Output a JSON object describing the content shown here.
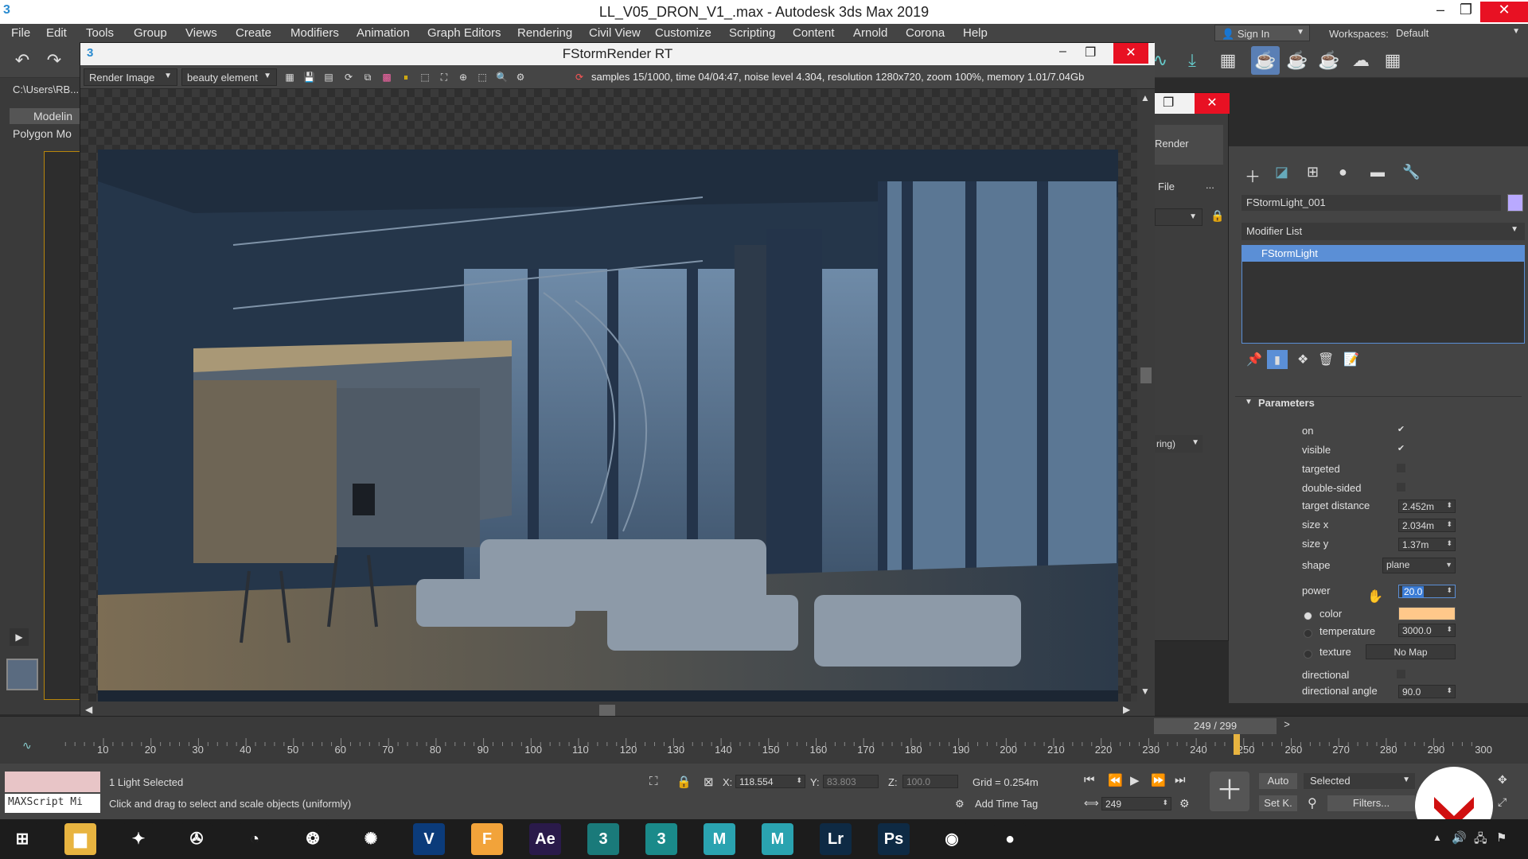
{
  "window": {
    "title": "LL_V05_DRON_V1_.max - Autodesk 3ds Max 2019"
  },
  "menu": [
    "File",
    "Edit",
    "Tools",
    "Group",
    "Views",
    "Create",
    "Modifiers",
    "Animation",
    "Graph Editors",
    "Rendering",
    "Civil View",
    "Customize",
    "Scripting",
    "Content",
    "Arnold",
    "Corona",
    "Help"
  ],
  "account": {
    "sign_in": "Sign In",
    "workspaces_label": "Workspaces:",
    "workspace": "Default"
  },
  "left": {
    "path": "C:\\Users\\RB...",
    "ribbon_tab": "Modelin",
    "ribbon_sub": "Polygon Mo",
    "viewport_label": "[+]["
  },
  "render_window": {
    "title": "FStormRender RT",
    "render_dropdown": "Render Image",
    "element_dropdown": "beauty element",
    "status": "samples 15/1000,  time 04/04:47,  noise level 4.304,  resolution 1280x720,  zoom 100%,  memory 1.01/7.04Gb"
  },
  "bg_dialog": {
    "render_label": "Render",
    "file_label": "File",
    "more": "...",
    "dropdown_tail": "ring)"
  },
  "command_panel": {
    "object_name": "FStormLight_001",
    "modifier_list": "Modifier List",
    "stack_item": "FStormLight",
    "rollout_title": "Parameters",
    "params": {
      "on": {
        "label": "on",
        "checked": true
      },
      "visible": {
        "label": "visible",
        "checked": true
      },
      "targeted": {
        "label": "targeted",
        "checked": false
      },
      "double_sided": {
        "label": "double-sided",
        "checked": false
      },
      "target_distance": {
        "label": "target distance",
        "value": "2.452m"
      },
      "size_x": {
        "label": "size x",
        "value": "2.034m"
      },
      "size_y": {
        "label": "size y",
        "value": "1.37m"
      },
      "shape": {
        "label": "shape",
        "value": "plane"
      },
      "power": {
        "label": "power",
        "value": "20.0"
      },
      "color": {
        "label": "color",
        "swatch": "#ffc88a"
      },
      "temperature": {
        "label": "temperature",
        "value": "3000.0"
      },
      "texture": {
        "label": "texture",
        "value": "No Map"
      },
      "directional": {
        "label": "directional",
        "checked": false
      },
      "directional_angle": {
        "label": "directional angle",
        "value": "90.0"
      }
    }
  },
  "timeline": {
    "frame_counter": "249 / 299",
    "next": ">",
    "ticks": [
      "10",
      "20",
      "30",
      "40",
      "50",
      "60",
      "70",
      "80",
      "90",
      "100",
      "110",
      "120",
      "130",
      "140",
      "150",
      "160",
      "170",
      "180",
      "190",
      "200",
      "210",
      "220",
      "230",
      "240",
      "250",
      "260",
      "270",
      "280",
      "290",
      "300"
    ],
    "current_frame": 250
  },
  "status_bar": {
    "maxscript": "MAXScript Mi",
    "selection": "1 Light Selected",
    "prompt": "Click and drag to select and scale objects (uniformly)",
    "x_label": "X:",
    "x_value": "118.554",
    "y_label": "Y:",
    "y_value": "83.803",
    "z_label": "Z:",
    "z_value": "100.0",
    "grid": "Grid = 0.254m",
    "add_time_tag": "Add Time Tag",
    "frame_field": "249",
    "auto": "Auto",
    "set_key": "Set K.",
    "key_mode": "Selected",
    "filters": "Filters..."
  },
  "taskbar": {
    "apps": [
      {
        "name": "windows-start-icon",
        "glyph": "⊞",
        "color": "#1c1c1c"
      },
      {
        "name": "file-explorer-icon",
        "glyph": "▆",
        "color": "#e8b440"
      },
      {
        "name": "satellite-app-icon",
        "glyph": "✦",
        "color": "#1c1c1c"
      },
      {
        "name": "film-reel-icon",
        "glyph": "✇",
        "color": "#1c1c1c"
      },
      {
        "name": "blender-icon",
        "glyph": "◔",
        "color": "#1c1c1c"
      },
      {
        "name": "fusion-icon",
        "glyph": "❂",
        "color": "#1c1c1c"
      },
      {
        "name": "davinci-resolve-icon",
        "glyph": "✺",
        "color": "#1c1c1c"
      },
      {
        "name": "vray-icon",
        "glyph": "V",
        "color": "#0b3b7a"
      },
      {
        "name": "fstorm-icon",
        "glyph": "F",
        "color": "#f2a33a"
      },
      {
        "name": "after-effects-icon",
        "glyph": "Ae",
        "color": "#2a1a4a"
      },
      {
        "name": "3dsmax-icon",
        "glyph": "3",
        "color": "#1a7a7a"
      },
      {
        "name": "3dsmax-active-icon",
        "glyph": "3",
        "color": "#1a8a8a"
      },
      {
        "name": "maya-icon",
        "glyph": "M",
        "color": "#2aa3b0"
      },
      {
        "name": "maya-2-icon",
        "glyph": "M",
        "color": "#2aa3b0"
      },
      {
        "name": "lightroom-icon",
        "glyph": "Lr",
        "color": "#0e2a44"
      },
      {
        "name": "photoshop-icon",
        "glyph": "Ps",
        "color": "#0e2a44"
      },
      {
        "name": "chrome-icon",
        "glyph": "◉",
        "color": "#1c1c1c"
      },
      {
        "name": "record-icon",
        "glyph": "●",
        "color": "#1c1c1c"
      }
    ]
  },
  "colors": {
    "accent": "#3a7bd5",
    "selection": "#5b8fd6",
    "time_slider": "#e8b440",
    "swatch_purple": "#b9a9ff"
  }
}
